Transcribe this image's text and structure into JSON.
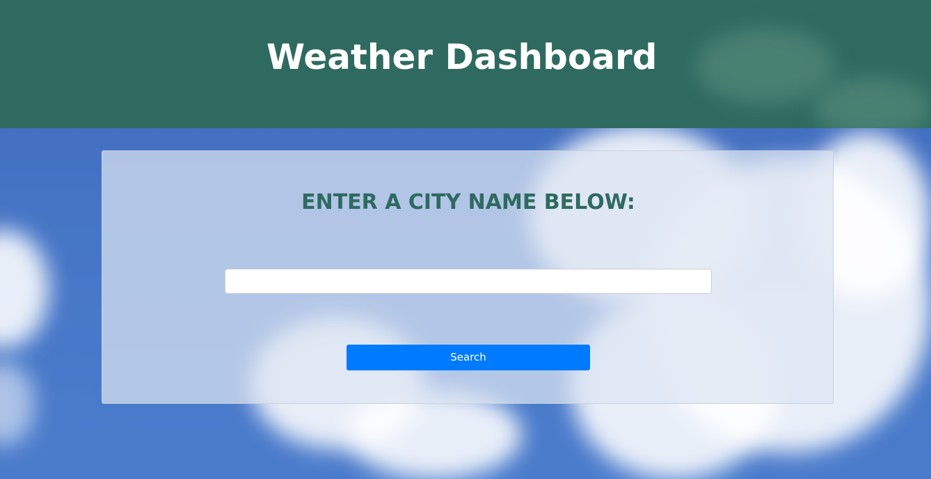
{
  "header": {
    "title": "Weather Dashboard"
  },
  "search_panel": {
    "prompt": "ENTER A CITY NAME BELOW:",
    "city_input_value": "",
    "city_input_placeholder": "",
    "search_button_label": "Search"
  },
  "colors": {
    "header_background": "#2f6a60",
    "heading_text": "#2f6a60",
    "button_background": "#007bff",
    "button_text": "#ffffff",
    "sky": "#4675c6"
  }
}
